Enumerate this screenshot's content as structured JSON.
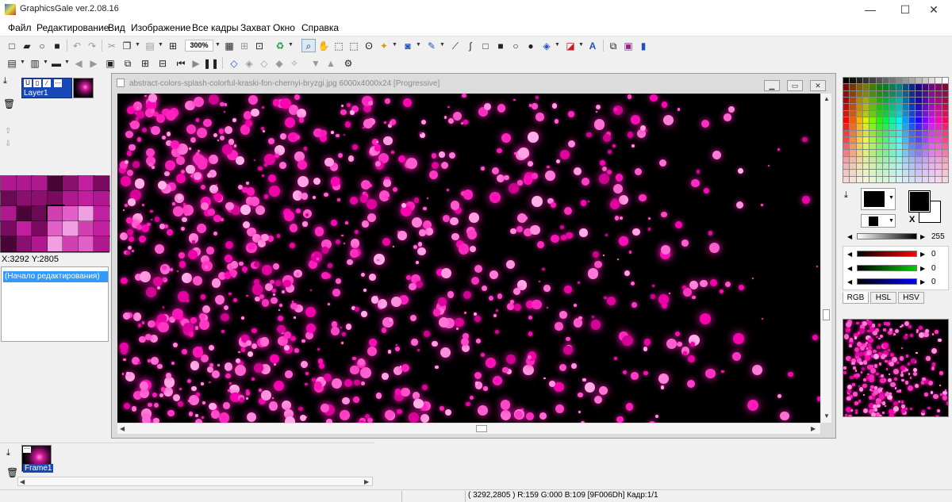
{
  "window": {
    "title": "GraphicsGale ver.2.08.16",
    "minimize": "—",
    "maximize": "☐",
    "close": "✕"
  },
  "menu": [
    "Файл",
    "Редактирование",
    "Вид",
    "Изображение",
    "Все кадры",
    "Захват",
    "Окно",
    "Справка"
  ],
  "toolbar": {
    "zoom": "300%"
  },
  "layer_panel": {
    "layer_name": "Layer1"
  },
  "palette_preview": {
    "coords": "X:3292 Y:2805"
  },
  "history": {
    "items": [
      "(Начало редактирования)"
    ]
  },
  "document": {
    "title": "abstract-colors-splash-colorful-kraski-fon-chernyi-bryzgi.jpg 6000x4000x24 [Progressive]"
  },
  "color_panel": {
    "gray_value": "255",
    "r_value": "0",
    "g_value": "0",
    "b_value": "0",
    "tabs": [
      "RGB",
      "HSL",
      "HSV"
    ],
    "swap_label": "X"
  },
  "frame_panel": {
    "frame_name": "Frame1"
  },
  "status": {
    "text": "( 3292,2805 ) R:159 G:000 B:109  [9F006Dh]  Кадр:1/1"
  },
  "colors": {
    "accent": "#3399ff",
    "brand_magenta": "#ff2bbd",
    "pixel": "#9F006D"
  }
}
